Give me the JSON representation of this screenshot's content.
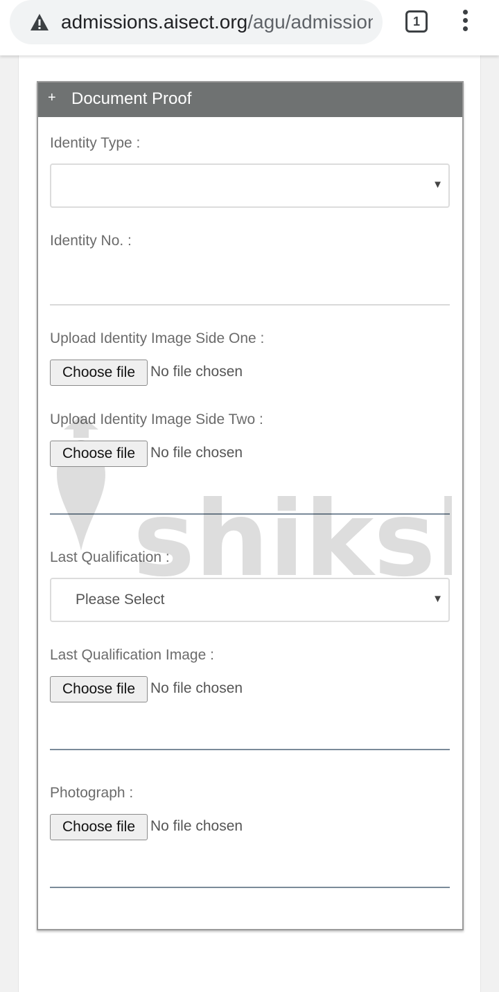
{
  "browser": {
    "url_host": "admissions.aisect.org",
    "url_path": "/agu/admission",
    "tab_count": "1"
  },
  "panel": {
    "toggle_symbol": "+",
    "title": "Document Proof"
  },
  "form": {
    "identity_type_label": "Identity Type :",
    "identity_type_value": "",
    "identity_no_label": "Identity No. :",
    "identity_no_value": "",
    "upload_side_one_label": "Upload Identity Image Side One :",
    "upload_side_two_label": "Upload Identity Image Side Two :",
    "last_qualification_label": "Last Qualification :",
    "last_qualification_value": "Please Select",
    "last_qualification_image_label": "Last Qualification Image :",
    "photograph_label": "Photograph :",
    "choose_file_label": "Choose file",
    "no_file_text": "No file chosen"
  },
  "watermark": {
    "brand": "shiksha"
  },
  "icons": {
    "address_warning": "warning-triangle-icon",
    "select_caret": "caret-down-icon",
    "overflow_menu": "vertical-dots-icon"
  }
}
